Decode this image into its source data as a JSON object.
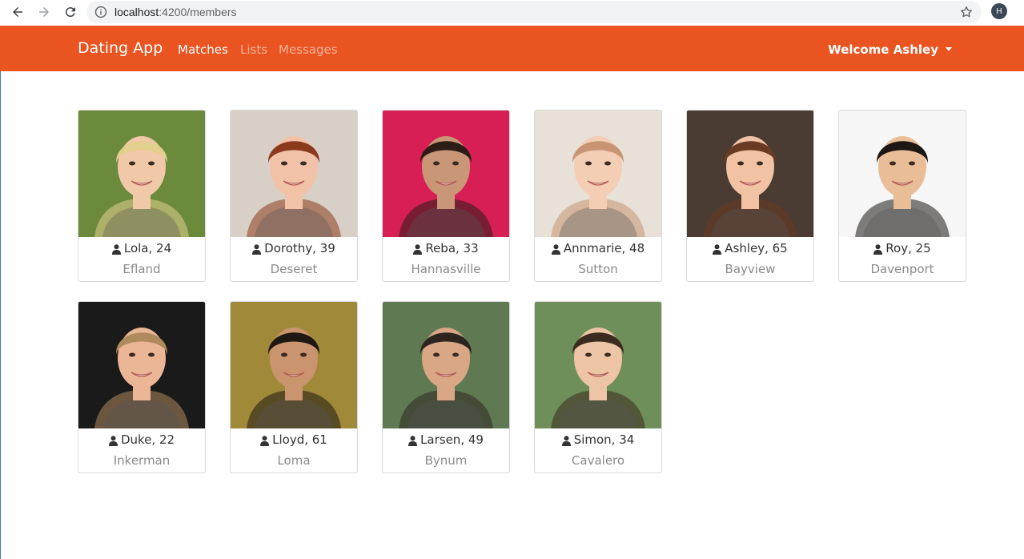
{
  "browser": {
    "url_host": "localhost",
    "url_path": ":4200/members",
    "profile_initial": "H"
  },
  "navbar": {
    "brand": "Dating App",
    "links": [
      "Matches",
      "Lists",
      "Messages"
    ],
    "welcome": "Welcome Ashley"
  },
  "colors": {
    "navbar": "#e95420",
    "city_text": "#8a8a8a"
  },
  "members": [
    {
      "name": "Lola, 24",
      "city": "Efland",
      "bg": "#6b8a3c",
      "skin": "#f0c9a8",
      "hair": "#e3cf8e"
    },
    {
      "name": "Dorothy, 39",
      "city": "Deseret",
      "bg": "#d8d0c6",
      "skin": "#f2c2a8",
      "hair": "#8c3a1e"
    },
    {
      "name": "Reba, 33",
      "city": "Hannasville",
      "bg": "#d81f55",
      "skin": "#c99677",
      "hair": "#2b1d16"
    },
    {
      "name": "Annmarie, 48",
      "city": "Sutton",
      "bg": "#e7e1d8",
      "skin": "#f4cdb5",
      "hair": "#c79573"
    },
    {
      "name": "Ashley, 65",
      "city": "Bayview",
      "bg": "#4a3b33",
      "skin": "#f1c2a4",
      "hair": "#6a3a22"
    },
    {
      "name": "Roy, 25",
      "city": "Davenport",
      "bg": "#f6f6f6",
      "skin": "#e8bd97",
      "hair": "#1c1714"
    },
    {
      "name": "Duke, 22",
      "city": "Inkerman",
      "bg": "#1a1a1a",
      "skin": "#eab696",
      "hair": "#b08a5c"
    },
    {
      "name": "Lloyd, 61",
      "city": "Loma",
      "bg": "#a08a3a",
      "skin": "#c9946e",
      "hair": "#1e1712"
    },
    {
      "name": "Larsen, 49",
      "city": "Bynum",
      "bg": "#5f7a52",
      "skin": "#d9a686",
      "hair": "#2d2420"
    },
    {
      "name": "Simon, 34",
      "city": "Cavalero",
      "bg": "#6f8f5a",
      "skin": "#eec4a6",
      "hair": "#3a2a1f"
    }
  ]
}
